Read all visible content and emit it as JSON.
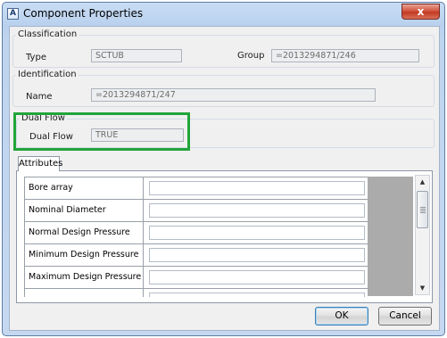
{
  "window": {
    "title": "Component Properties",
    "close_glyph": "x",
    "icon": "app-icon"
  },
  "classification": {
    "legend": "Classification",
    "type_label": "Type",
    "type_value": "SCTUB",
    "group_label": "Group",
    "group_value": "=2013294871/246"
  },
  "identification": {
    "legend": "Identification",
    "name_label": "Name",
    "name_value": "=2013294871/247"
  },
  "dual_flow": {
    "legend": "Dual Flow",
    "label": "Dual Flow",
    "value": "TRUE"
  },
  "attributes": {
    "tab_label": "Attributes",
    "rows": [
      {
        "name": "Bore array",
        "value": ""
      },
      {
        "name": "Nominal Diameter",
        "value": ""
      },
      {
        "name": "Normal Design Pressure",
        "value": ""
      },
      {
        "name": "Minimum Design Pressure",
        "value": ""
      },
      {
        "name": "Maximum Design Pressure",
        "value": ""
      },
      {
        "name": "",
        "value": ""
      }
    ]
  },
  "buttons": {
    "ok": "OK",
    "cancel": "Cancel"
  },
  "colors": {
    "highlight": "#21a53a",
    "close_button": "#c23a22"
  }
}
